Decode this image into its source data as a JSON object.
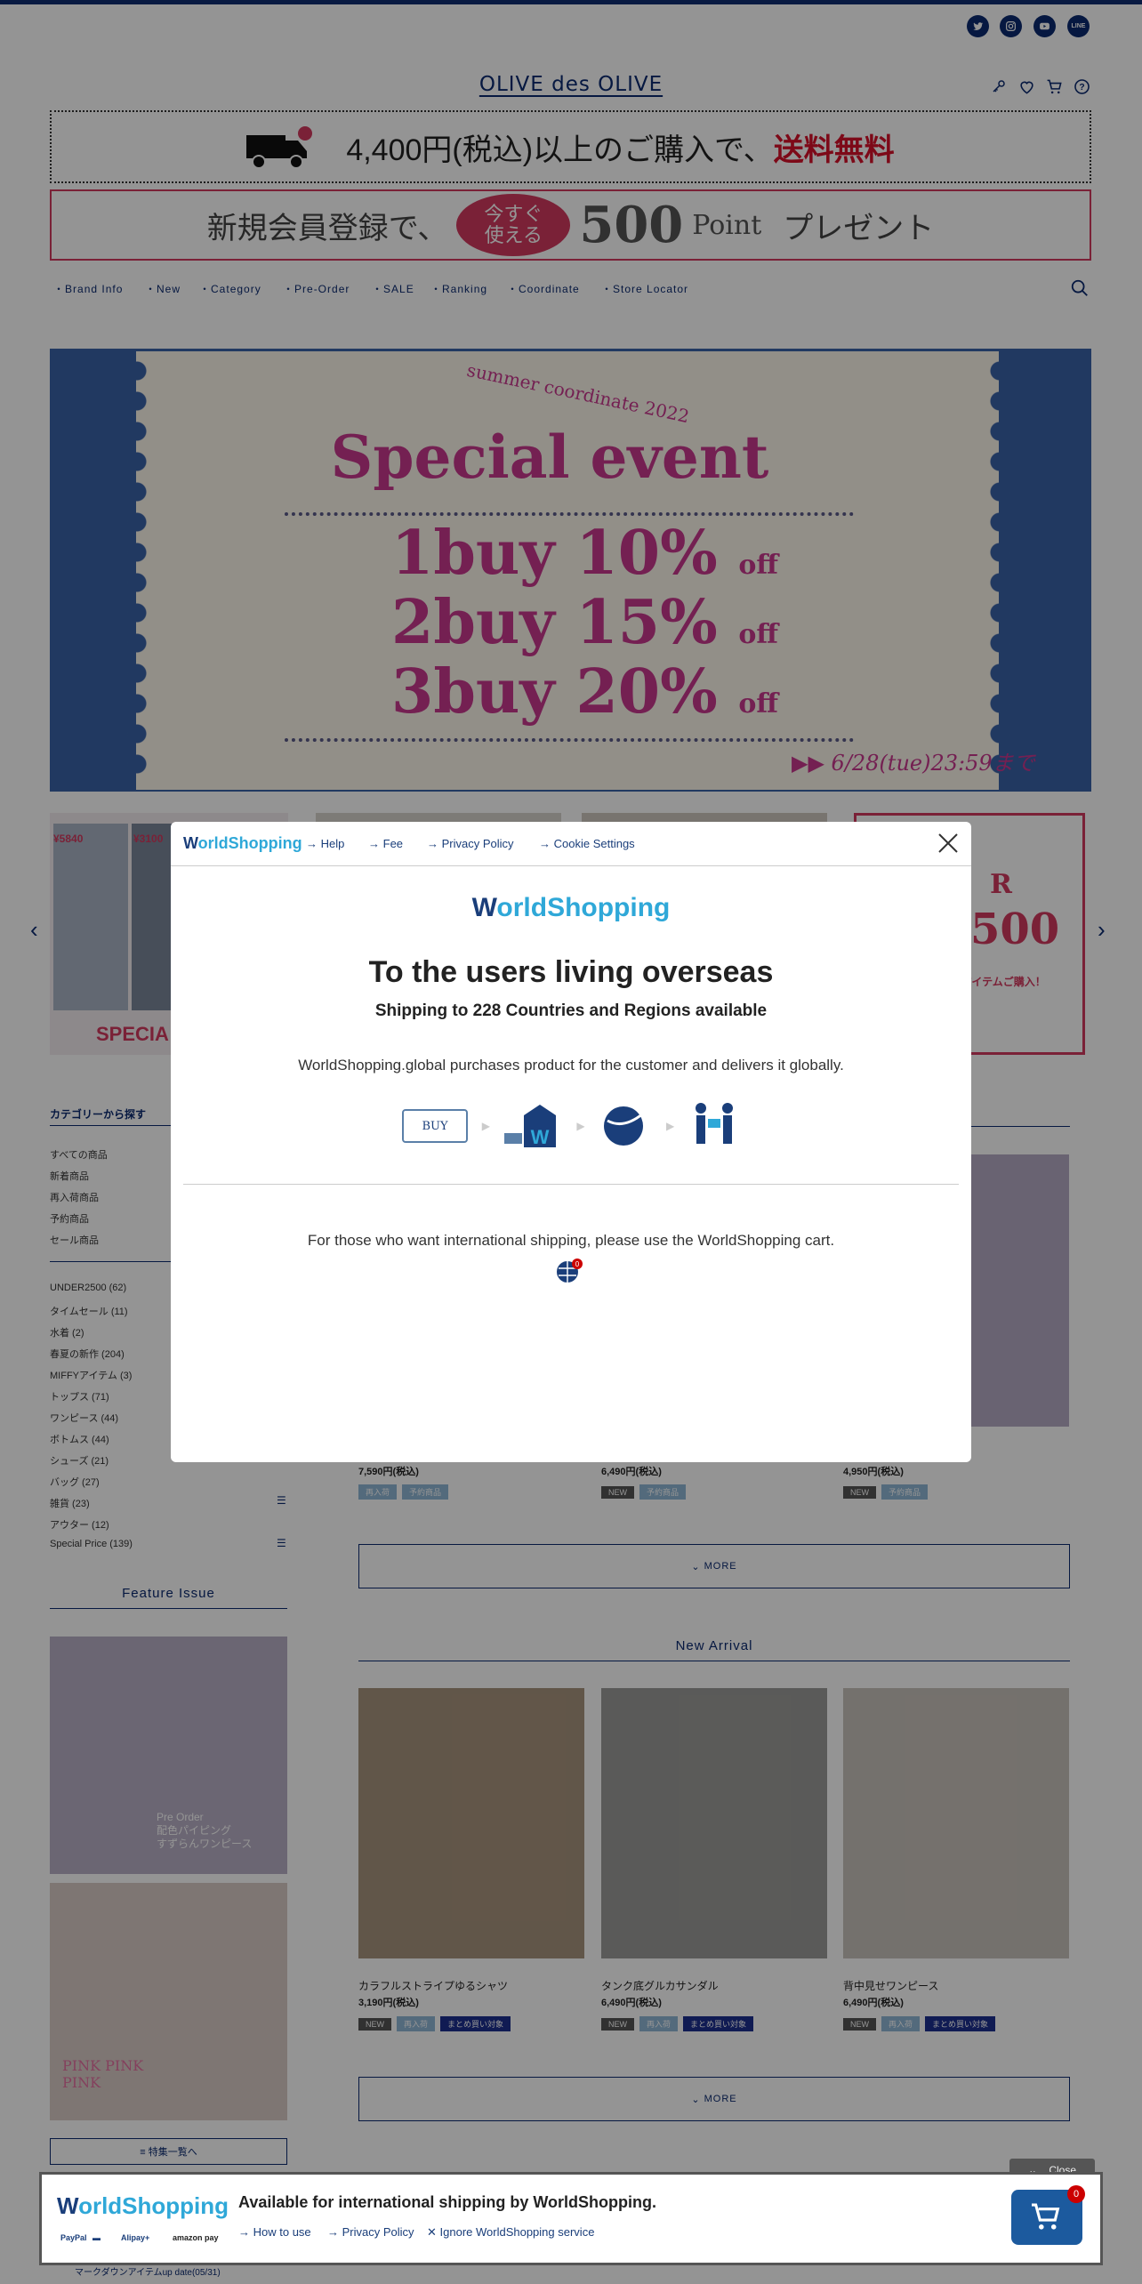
{
  "header": {
    "logo": "OLIVE des OLIVE",
    "social": [
      "twitter-icon",
      "instagram-icon",
      "youtube-icon",
      "line-icon"
    ],
    "line_label": "LINE"
  },
  "promo": {
    "shipping_main": "4,400円(税込)以上のご購入で、",
    "shipping_red": "送料無料",
    "gift_label": "🎁",
    "signup_prefix": "新規会員登録で、",
    "signup_bubble": "今すぐ\n使える",
    "signup_points": "500",
    "signup_point_word": "Point",
    "signup_suffix": "プレゼント"
  },
  "nav": [
    "Brand Info",
    "New",
    "Category",
    "Pre-Order",
    "SALE",
    "Ranking",
    "Coordinate",
    "Store Locator"
  ],
  "hero": {
    "subtitle": "summer coordinate 2022",
    "title": "Special event",
    "offers": [
      {
        "num": "1buy 10%",
        "suffix": "off"
      },
      {
        "num": "2buy 15%",
        "suffix": "off"
      },
      {
        "num": "3buy 20%",
        "suffix": "off"
      }
    ],
    "deadline": "▶▶ 6/28(tue)23:59まで"
  },
  "carousel": {
    "card1_text": "SPECIA",
    "card1_price_a": "¥5840",
    "card1_price_b": "¥3100",
    "card4_big": "500",
    "card4_r": "R",
    "card4_note": "アイテムご購入！"
  },
  "sidebar": {
    "category_title": "カテゴリーから探す",
    "basic": [
      "すべての商品",
      "新着商品",
      "再入荷商品",
      "予約商品",
      "セール商品"
    ],
    "categories": [
      "UNDER2500 (62)",
      "タイムセール (11)",
      "水着 (2)",
      "春夏の新作 (204)",
      "MIFFYアイテム (3)",
      "トップス (71)",
      "ワンピース (44)",
      "ボトムス (44)",
      "シューズ (21)",
      "バッグ (27)",
      "雑貨 (23)",
      "アウター (12)",
      "Special Price (139)"
    ],
    "feature_title": "Feature Issue",
    "feature1_text": "Pre Order\n配色パイピング\nすずらんワンピース",
    "feature2_text": "PINK PINK PINK",
    "feature_list_button": "≡ 特集一覧へ",
    "markdown_link": "マークダウンアイテムup date(05/31)"
  },
  "ranking_row": {
    "prices": [
      "7,590円(税込)",
      "6,490円(税込)",
      "4,950円(税込)"
    ],
    "tags": [
      [
        "再入荷",
        "予約商品"
      ],
      [
        "NEW",
        "予約商品"
      ],
      [
        "NEW",
        "予約商品"
      ]
    ],
    "more": "MORE"
  },
  "new_arrival": {
    "title": "New Arrival",
    "items": [
      {
        "name": "カラフルストライプゆるシャツ",
        "price": "3,190円(税込)",
        "tags": [
          "NEW",
          "再入荷",
          "まとめ買い対象"
        ]
      },
      {
        "name": "タンク底グルカサンダル",
        "price": "6,490円(税込)",
        "tags": [
          "NEW",
          "再入荷",
          "まとめ買い対象"
        ]
      },
      {
        "name": "背中見せワンピース",
        "price": "6,490円(税込)",
        "tags": [
          "NEW",
          "再入荷",
          "まとめ買い対象"
        ]
      }
    ],
    "more": "MORE"
  },
  "modal": {
    "logo_w": "W",
    "logo_rest": "orldShopping",
    "links": [
      "Help",
      "Fee",
      "Privacy Policy",
      "Cookie Settings"
    ],
    "title": "To the users living overseas",
    "subtitle": "Shipping to 228 Countries and Regions available",
    "description": "WorldShopping.global purchases product for the customer and delivers it globally.",
    "buy_label": "BUY",
    "note": "For those who want international shipping, please use the WorldShopping cart.",
    "cart_badge": "0"
  },
  "footer_bar": {
    "title": "Available for international shipping by WorldShopping.",
    "links": [
      "How to use",
      "Privacy Policy",
      "Ignore WorldShopping service"
    ],
    "close": "Close",
    "cart_count": "0",
    "payments": [
      "PayPal",
      "Alipay+",
      "amazon pay"
    ]
  },
  "colors": {
    "navy": "#0b2a70",
    "pink": "#c8378e",
    "red": "#d7102a",
    "hero_blue": "#3a63a8"
  }
}
